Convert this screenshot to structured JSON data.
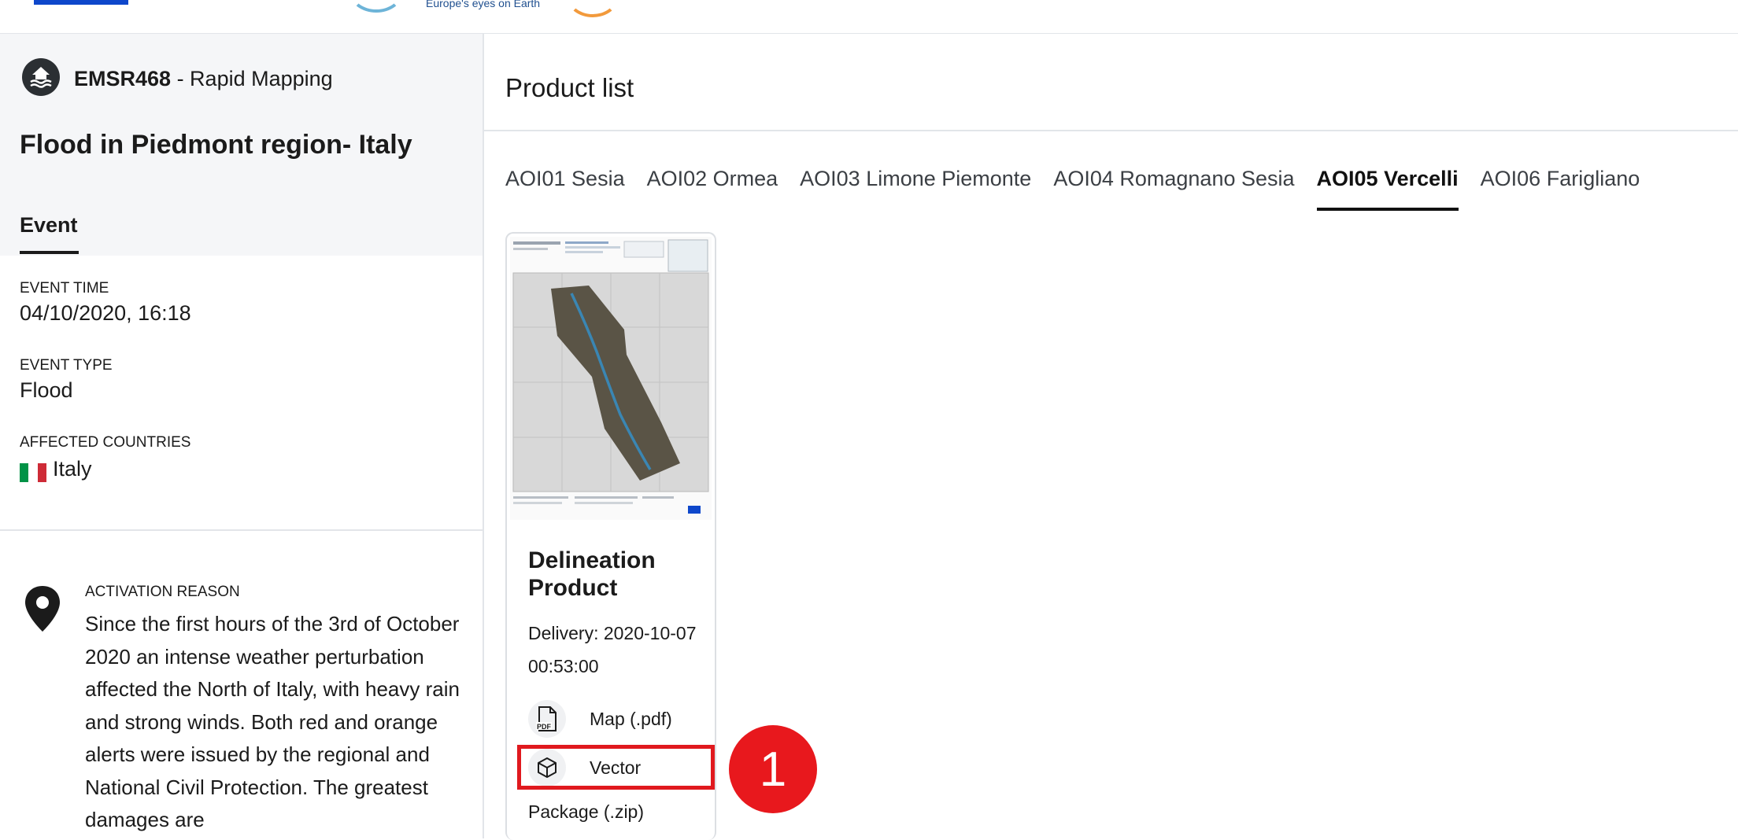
{
  "header": {
    "tagline": "Europe's eyes on Earth"
  },
  "activation": {
    "code": "EMSR468",
    "type_suffix": " - Rapid Mapping",
    "title": "Flood in Piedmont region- Italy"
  },
  "left_tabs": {
    "event": "Event"
  },
  "event": {
    "time_label": "EVENT TIME",
    "time_value": "04/10/2020, 16:18",
    "type_label": "EVENT TYPE",
    "type_value": "Flood",
    "countries_label": "AFFECTED COUNTRIES",
    "country": "Italy",
    "flag_colors": [
      "#009246",
      "#ffffff",
      "#ce2b37"
    ]
  },
  "reason": {
    "label": "ACTIVATION REASON",
    "text": "Since the first hours of the 3rd of October 2020 an intense weather perturbation affected the North of Italy, with heavy rain and strong winds. Both red and orange alerts were issued by the regional and National Civil Protection. The greatest damages are"
  },
  "product_list": {
    "title": "Product list",
    "tabs": [
      {
        "label": "AOI01 Sesia",
        "active": false
      },
      {
        "label": "AOI02 Ormea",
        "active": false
      },
      {
        "label": "AOI03 Limone Piemonte",
        "active": false
      },
      {
        "label": "AOI04 Romagnano Sesia",
        "active": false
      },
      {
        "label": "AOI05 Vercelli",
        "active": true
      },
      {
        "label": "AOI06 Farigliano",
        "active": false
      }
    ]
  },
  "product_card": {
    "title": "Delineation Product",
    "delivery": "Delivery: 2020-10-07 00:53:00",
    "map_label": "Map (.pdf)",
    "vector_label": "Vector",
    "package_label": "Package (.zip)",
    "pdf_icon_text": "PDF"
  },
  "annotation": {
    "marker_number": "1"
  },
  "colors": {
    "accent_red": "#e0191e",
    "text": "#1b1b1b",
    "panel_bg": "#f5f6f8"
  }
}
